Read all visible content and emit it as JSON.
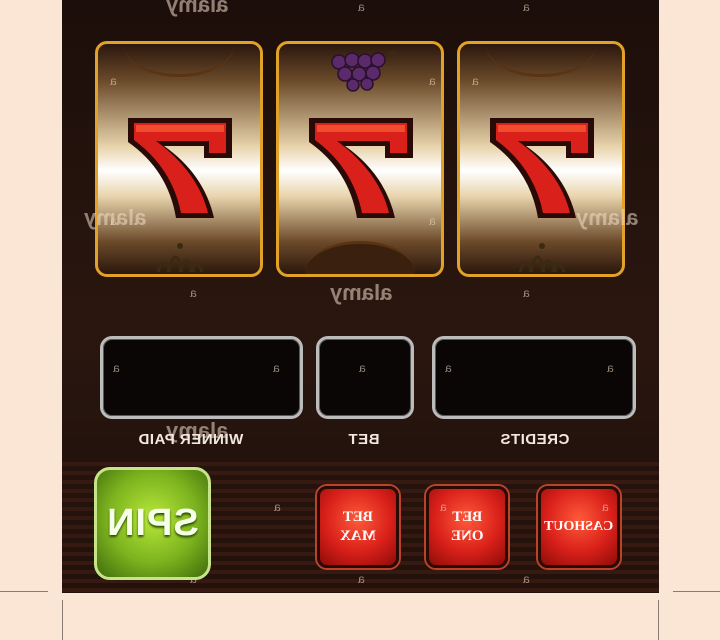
{
  "reels": [
    {
      "symbol": "7",
      "top_symbol": "",
      "bottom_symbol": "plant"
    },
    {
      "symbol": "7",
      "top_symbol": "grapes",
      "bottom_symbol": ""
    },
    {
      "symbol": "7",
      "top_symbol": "",
      "bottom_symbol": "plant"
    }
  ],
  "displays": {
    "winner_paid": {
      "label": "WINNER PAID",
      "value": ""
    },
    "bet": {
      "label": "BET",
      "value": ""
    },
    "credits": {
      "label": "CREDITS",
      "value": ""
    }
  },
  "buttons": {
    "spin": "SPIN",
    "bet_max": "BET\nMAX",
    "bet_one": "BET\nONE",
    "cashout": "CASHOUT"
  },
  "watermark": {
    "brand": "alamy",
    "mark": "a"
  },
  "colors": {
    "reel_border": "#e1a227",
    "seven_red": "#d9201a",
    "spin_green": "#7cb31e",
    "background": "#fbe6d5"
  }
}
